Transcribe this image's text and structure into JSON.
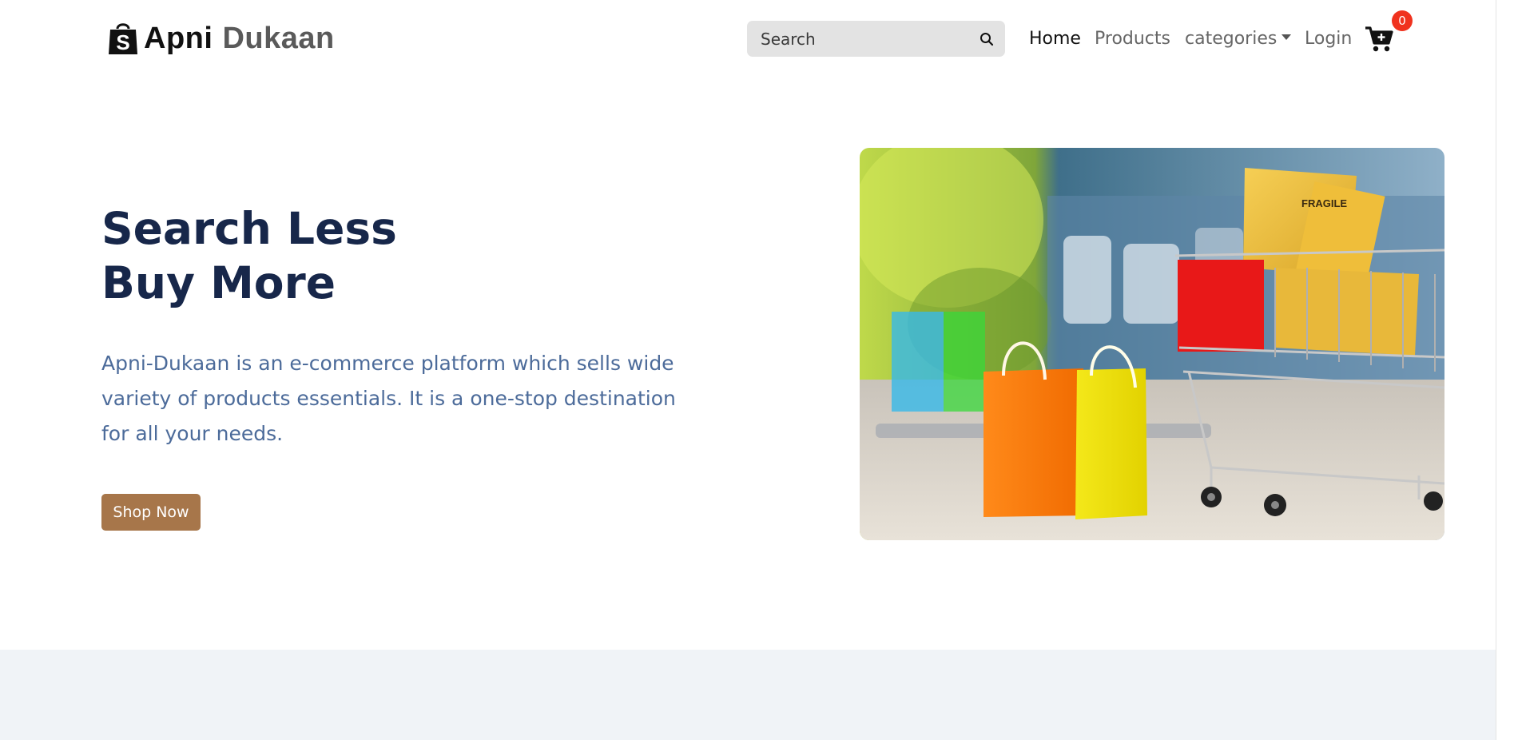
{
  "header": {
    "brand_first": "Apni",
    "brand_second": "Dukaan",
    "logo_icon": "shopping-bag-icon",
    "search": {
      "placeholder": "Search",
      "icon": "search-icon"
    },
    "nav": {
      "home": "Home",
      "products": "Products",
      "categories": "categories",
      "login": "Login"
    },
    "cart": {
      "icon": "shopping-cart-icon",
      "count": "0"
    }
  },
  "hero": {
    "title_line1": "Search Less",
    "title_line2": "Buy More",
    "description": "Apni-Dukaan is an e-commerce platform which sells wide variety of products essentials. It is a one-stop destination for all your needs.",
    "cta_label": "Shop Now",
    "image_label": "FRAGILE"
  },
  "colors": {
    "title": "#17274a",
    "description": "#4c6b9a",
    "cta": "#a7764a",
    "badge": "#f0321e",
    "band": "#f0f3f7"
  }
}
